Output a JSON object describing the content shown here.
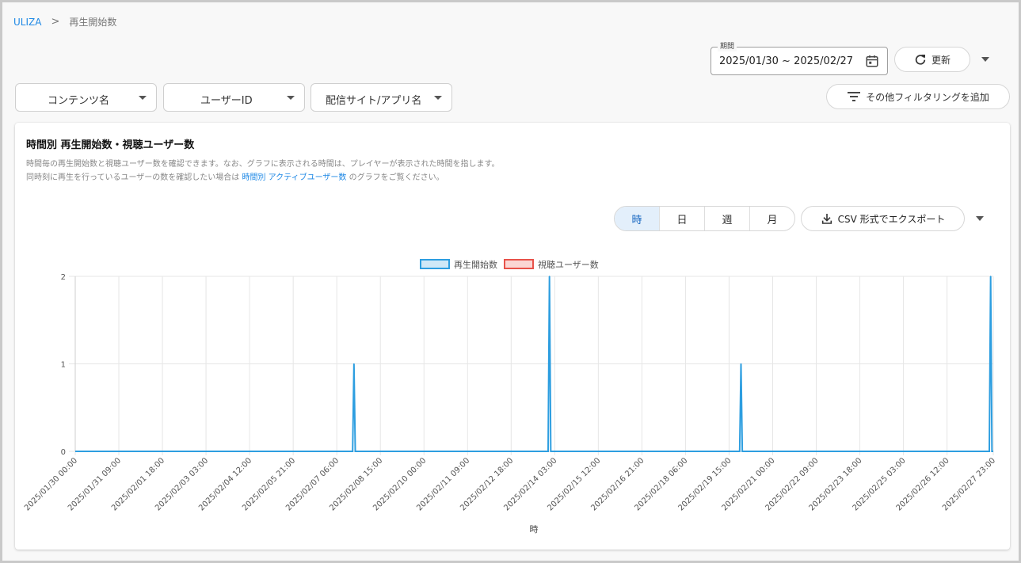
{
  "breadcrumb": {
    "root": "ULIZA",
    "separator": ">",
    "current": "再生開始数"
  },
  "date_range": {
    "legend": "期間",
    "value": "2025/01/30 ~ 2025/02/27"
  },
  "refresh": {
    "label": "更新"
  },
  "filters": [
    {
      "label": "コンテンツ名"
    },
    {
      "label": "ユーザーID"
    },
    {
      "label": "配信サイト/アプリ名"
    }
  ],
  "add_filter": {
    "label": "その他フィルタリングを追加"
  },
  "card": {
    "title": "時間別 再生開始数・視聴ユーザー数",
    "desc1": "時間毎の再生開始数と視聴ユーザー数を確認できます。なお、グラフに表示される時間は、プレイヤーが表示された時間を指します。",
    "desc2_pre": "同時刻に再生を行っているユーザーの数を確認したい場合は",
    "desc2_link": "時間別 アクティブユーザー数",
    "desc2_post": "のグラフをご覧ください。"
  },
  "granularity": {
    "options": [
      "時",
      "日",
      "週",
      "月"
    ],
    "selected": "時"
  },
  "export": {
    "label": "CSV 形式でエクスポート"
  },
  "colors": {
    "accent": "#1e88e5",
    "series1": "#2d9ee0",
    "series1_fill": "#cfe8f7",
    "series2": "#e8524a",
    "series2_fill": "#fbd6d4"
  },
  "chart_data": {
    "type": "line",
    "x_tick_labels": [
      "2025/01/30 00:00",
      "2025/01/31 09:00",
      "2025/02/01 18:00",
      "2025/02/03 03:00",
      "2025/02/04 12:00",
      "2025/02/05 21:00",
      "2025/02/07 06:00",
      "2025/02/08 15:00",
      "2025/02/10 00:00",
      "2025/02/11 09:00",
      "2025/02/12 18:00",
      "2025/02/14 03:00",
      "2025/02/15 12:00",
      "2025/02/16 21:00",
      "2025/02/18 06:00",
      "2025/02/19 15:00",
      "2025/02/21 00:00",
      "2025/02/22 09:00",
      "2025/02/23 18:00",
      "2025/02/25 03:00",
      "2025/02/26 12:00",
      "2025/02/27 23:00"
    ],
    "x_range": [
      "2025/01/30 00:00",
      "2025/02/27 23:00"
    ],
    "xlabel": "時",
    "ylim": [
      0,
      2
    ],
    "y_ticks": [
      0,
      1,
      2
    ],
    "legend_position": "top-center",
    "grid": true,
    "series": [
      {
        "name": "再生開始数",
        "points": [
          {
            "x": "2025/02/07 19:00",
            "y": 1
          },
          {
            "x": "2025/02/13 23:00",
            "y": 2
          },
          {
            "x": "2025/02/20 00:00",
            "y": 1
          },
          {
            "x": "2025/02/27 21:00",
            "y": 2
          }
        ],
        "baseline": 0
      },
      {
        "name": "視聴ユーザー数",
        "points": [],
        "baseline": 0
      }
    ]
  }
}
